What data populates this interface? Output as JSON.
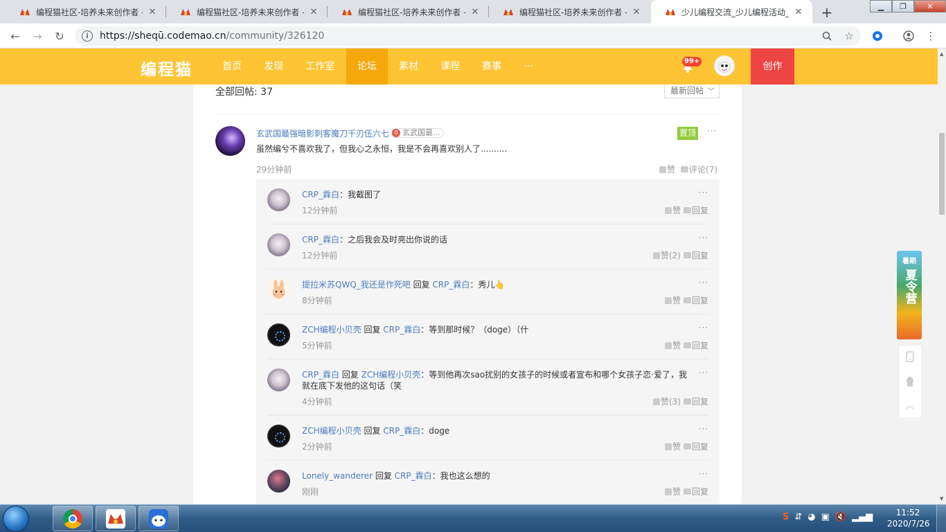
{
  "browser": {
    "tabs": [
      {
        "title": "编程猫社区-培养未来创作者 - 言",
        "active": false
      },
      {
        "title": "编程猫社区-培养未来创作者 - 言",
        "active": false
      },
      {
        "title": "编程猫社区-培养未来创作者 - 言",
        "active": false
      },
      {
        "title": "编程猫社区-培养未来创作者 - 言",
        "active": false
      },
      {
        "title": "少儿编程交流_少儿编程活动_sc",
        "active": true
      }
    ],
    "url_host": "https://sheqū.codemao.cn",
    "url_path": "/community/326120",
    "icons": [
      "back-icon",
      "forward-icon",
      "reload-icon",
      "info-icon",
      "zoom-icon",
      "star-icon",
      "extension-icon",
      "account-icon",
      "menu-icon"
    ]
  },
  "site": {
    "logo": "编程猫",
    "nav": [
      "首页",
      "发现",
      "工作室",
      "论坛",
      "素材",
      "课程",
      "赛事",
      "···"
    ],
    "active_nav": "论坛",
    "notification_badge": "99+",
    "create_label": "创作"
  },
  "thread": {
    "total_label": "全部回帖: 37",
    "sort_label": "最新回帖",
    "post": {
      "username": "玄武国最强暗影刺客魔刀千刃伍六七",
      "tag": "玄武国最...",
      "pinned_label": "置顶",
      "more": "···",
      "content": "虽然编兮不喜欢我了，但我心之永恒，我是不会再喜欢别人了..........",
      "time": "29分钟前",
      "like_label": "赞",
      "comment_label": "评论(7)"
    },
    "replies": [
      {
        "user": "CRP_霖白",
        "reply_word": "",
        "target": "",
        "text": "：我截图了",
        "time": "12分钟前",
        "like": "赞",
        "reply": "回复",
        "more": "···"
      },
      {
        "user": "CRP_霖白",
        "reply_word": "",
        "target": "",
        "text": "：之后我会及时亮出你说的话",
        "time": "12分钟前",
        "like": "赞(2)",
        "reply": "回复",
        "more": "···"
      },
      {
        "user": "提拉米苏QWQ_我还是作死吧",
        "reply_word": " 回复 ",
        "target": "CRP_霖白",
        "text": "：秀儿👆",
        "time": "8分钟前",
        "like": "赞",
        "reply": "回复",
        "more": "···"
      },
      {
        "user": "ZCH编程小贝壳",
        "reply_word": " 回复 ",
        "target": "CRP_霖白",
        "text": "：等到那时候？（doge）（什",
        "time": "5分钟前",
        "like": "赞",
        "reply": "回复",
        "more": "···"
      },
      {
        "user": "CRP_霖白",
        "reply_word": " 回复 ",
        "target": "ZCH编程小贝壳",
        "text": "：等到他再次sao扰别的女孩子的时候或者宣布和哪个女孩子恋·爱了，我就在底下发他的这句话（笑",
        "time": "4分钟前",
        "like": "赞(3)",
        "reply": "回复",
        "more": "···"
      },
      {
        "user": "ZCH编程小贝壳",
        "reply_word": " 回复 ",
        "target": "CRP_霖白",
        "text": "：doge",
        "time": "2分钟前",
        "like": "赞",
        "reply": "回复",
        "more": "···"
      },
      {
        "user": "Lonely_wanderer",
        "reply_word": " 回复 ",
        "target": "CRP_霖白",
        "text": "：我也这么想的",
        "time": "刚刚",
        "like": "赞",
        "reply": "回复",
        "more": "···"
      }
    ]
  },
  "side": {
    "banner_small": "暑期",
    "banner_text": "夏令营"
  },
  "taskbar": {
    "time": "11:52",
    "date": "2020/7/26"
  },
  "colors": {
    "header": "#fec433",
    "header_active": "#f5a80b",
    "create": "#ee4444",
    "username": "#4a7cc0",
    "pinned": "#90cc3b"
  }
}
